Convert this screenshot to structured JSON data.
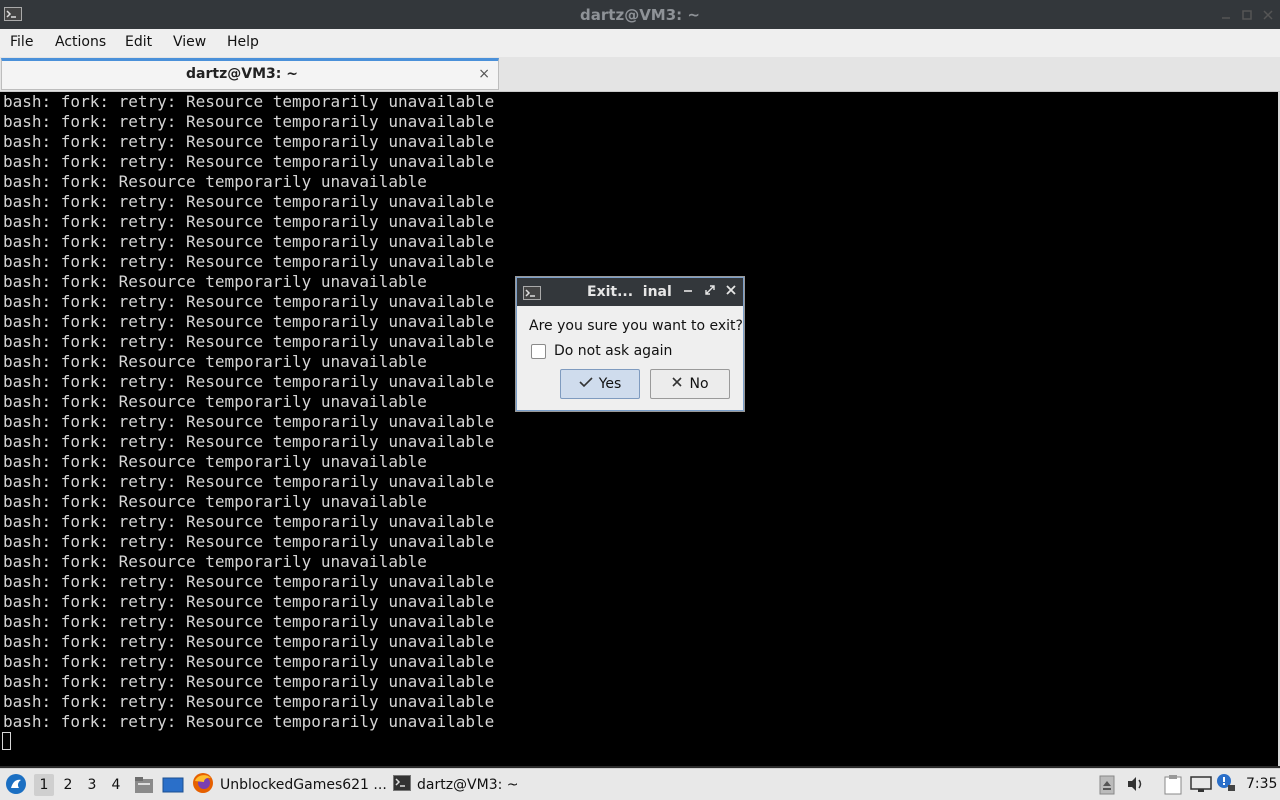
{
  "window": {
    "title": "dartz@VM3: ~"
  },
  "menu": [
    "File",
    "Actions",
    "Edit",
    "View",
    "Help"
  ],
  "tab": {
    "label": "dartz@VM3: ~",
    "close": "×"
  },
  "terminal": {
    "lines": [
      "bash: fork: retry: Resource temporarily unavailable",
      "bash: fork: retry: Resource temporarily unavailable",
      "bash: fork: retry: Resource temporarily unavailable",
      "bash: fork: retry: Resource temporarily unavailable",
      "bash: fork: Resource temporarily unavailable",
      "bash: fork: retry: Resource temporarily unavailable",
      "bash: fork: retry: Resource temporarily unavailable",
      "bash: fork: retry: Resource temporarily unavailable",
      "bash: fork: retry: Resource temporarily unavailable",
      "bash: fork: Resource temporarily unavailable",
      "bash: fork: retry: Resource temporarily unavailable",
      "bash: fork: retry: Resource temporarily unavailable",
      "bash: fork: retry: Resource temporarily unavailable",
      "bash: fork: Resource temporarily unavailable",
      "bash: fork: retry: Resource temporarily unavailable",
      "bash: fork: Resource temporarily unavailable",
      "bash: fork: retry: Resource temporarily unavailable",
      "bash: fork: retry: Resource temporarily unavailable",
      "bash: fork: Resource temporarily unavailable",
      "bash: fork: retry: Resource temporarily unavailable",
      "bash: fork: Resource temporarily unavailable",
      "bash: fork: retry: Resource temporarily unavailable",
      "bash: fork: retry: Resource temporarily unavailable",
      "bash: fork: Resource temporarily unavailable",
      "bash: fork: retry: Resource temporarily unavailable",
      "bash: fork: retry: Resource temporarily unavailable",
      "bash: fork: retry: Resource temporarily unavailable",
      "bash: fork: retry: Resource temporarily unavailable",
      "bash: fork: retry: Resource temporarily unavailable",
      "bash: fork: retry: Resource temporarily unavailable",
      "bash: fork: retry: Resource temporarily unavailable",
      "bash: fork: retry: Resource temporarily unavailable"
    ]
  },
  "dialog": {
    "title": "Exit...  inal",
    "question": "Are you sure you want to exit?",
    "checkbox_label": "Do not ask again",
    "checkbox_checked": false,
    "yes_label": "Yes",
    "no_label": "No"
  },
  "taskbar": {
    "workspaces": [
      "1",
      "2",
      "3",
      "4"
    ],
    "active_workspace": "1",
    "tasks": [
      {
        "label": "UnblockedGames621 ...",
        "icon": "firefox-icon"
      },
      {
        "label": "dartz@VM3: ~",
        "icon": "terminal-icon"
      }
    ],
    "clock": "7:35"
  },
  "colors": {
    "terminal_bg": "#000000",
    "terminal_fg": "#d6d6d6",
    "titlebar_bg": "#33373b",
    "accent": "#4a90d9"
  }
}
